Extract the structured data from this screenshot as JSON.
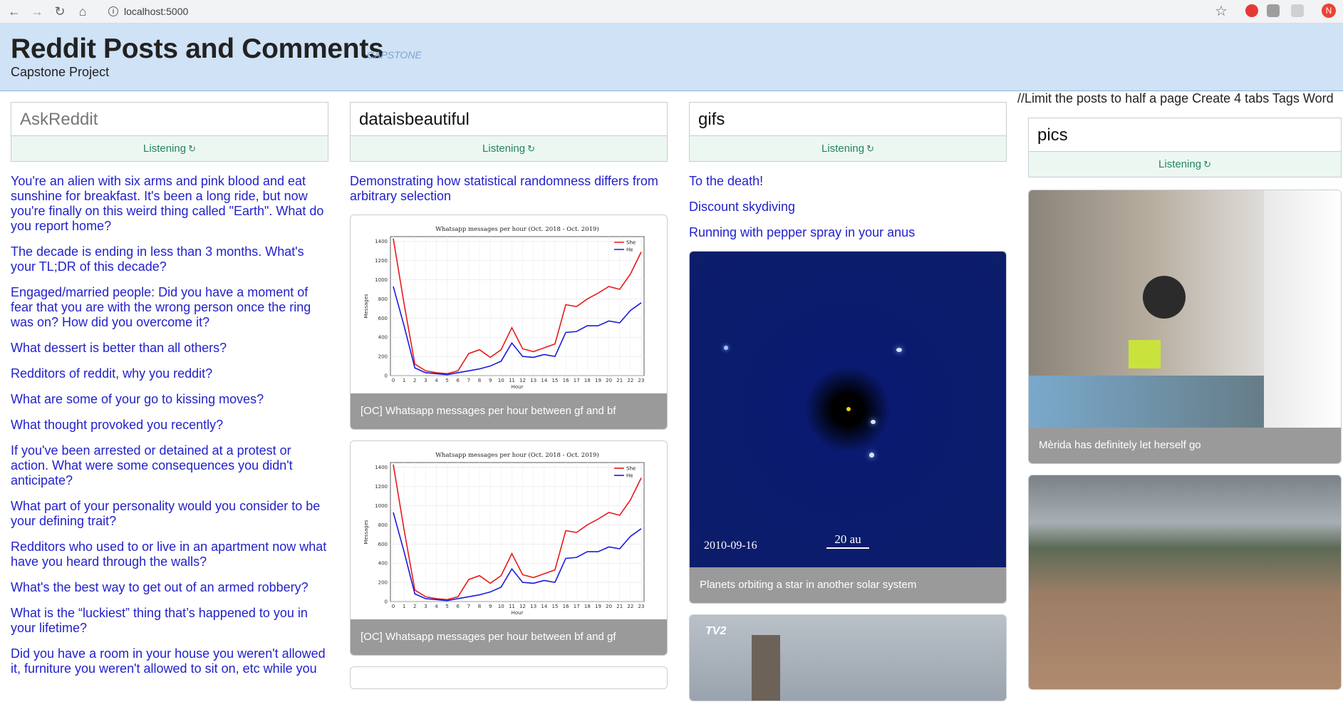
{
  "browser": {
    "url": "localhost:5000",
    "avatar_letter": "N"
  },
  "header": {
    "title": "Reddit Posts and Comments",
    "tag": "CAPSTONE",
    "subtitle": "Capstone Project",
    "note": "//Limit the posts to half a page Create 4 tabs Tags Word"
  },
  "columns": [
    {
      "subreddit": "AskReddit",
      "status": "Listening",
      "posts": [
        "You're an alien with six arms and pink blood and eat sunshine for breakfast. It's been a long ride, but now you're finally on this weird thing called \"Earth\". What do you report home?",
        "The decade is ending in less than 3 months. What's your TL;DR of this decade?",
        "Engaged/married people: Did you have a moment of fear that you are with the wrong person once the ring was on? How did you overcome it?",
        "What dessert is better than all others?",
        "Redditors of reddit, why you reddit?",
        "What are some of your go to kissing moves?",
        "What thought provoked you recently?",
        "If you've been arrested or detained at a protest or action. What were some consequences you didn't anticipate?",
        "What part of your personality would you consider to be your defining trait?",
        "Redditors who used to or live in an apartment now what have you heard through the walls?",
        "What's the best way to get out of an armed robbery?",
        "What is the “luckiest” thing that’s happened to you in your lifetime?",
        "Did you have a room in your house you weren't allowed it, furniture you weren't allowed to sit on, etc while you"
      ]
    },
    {
      "subreddit": "dataisbeautiful",
      "status": "Listening",
      "posts": [
        "Demonstrating how statistical randomness differs from arbitrary selection"
      ],
      "cards": [
        {
          "caption": "[OC] Whatsapp messages per hour between gf and bf"
        },
        {
          "caption": "[OC] Whatsapp messages per hour between bf and gf"
        }
      ]
    },
    {
      "subreddit": "gifs",
      "status": "Listening",
      "posts": [
        "To the death!",
        "Discount skydiving",
        "Running with pepper spray in your anus"
      ],
      "cards": [
        {
          "caption": "Planets orbiting a star in another solar system",
          "date": "2010-09-16",
          "scale": "20 au"
        },
        {
          "caption": "",
          "logo": "TV2"
        }
      ]
    },
    {
      "subreddit": "pics",
      "status": "Listening",
      "cards": [
        {
          "caption": "Mèrida has definitely let herself go"
        },
        {
          "caption": ""
        }
      ]
    }
  ],
  "chart_data": [
    {
      "type": "line",
      "title": "Whatsapp messages per hour (Oct. 2018 - Oct. 2019)",
      "xlabel": "Hour",
      "ylabel": "Messages",
      "categories": [
        0,
        1,
        2,
        3,
        4,
        5,
        6,
        7,
        8,
        9,
        10,
        11,
        12,
        13,
        14,
        15,
        16,
        17,
        18,
        19,
        20,
        21,
        22,
        23
      ],
      "ylim": [
        0,
        1450
      ],
      "yticks": [
        0,
        200,
        400,
        600,
        800,
        1000,
        1200,
        1400
      ],
      "series": [
        {
          "name": "She",
          "color": "#e8191b",
          "values": [
            1430,
            750,
            120,
            50,
            30,
            20,
            50,
            230,
            270,
            190,
            270,
            500,
            280,
            250,
            290,
            330,
            740,
            720,
            800,
            860,
            930,
            900,
            1060,
            1290
          ]
        },
        {
          "name": "He",
          "color": "#1a1ae0",
          "values": [
            930,
            520,
            80,
            30,
            20,
            10,
            30,
            50,
            70,
            100,
            150,
            340,
            200,
            190,
            220,
            200,
            450,
            460,
            520,
            520,
            570,
            550,
            680,
            760
          ]
        }
      ],
      "legend": "top-right",
      "grid": true
    },
    {
      "type": "line",
      "title": "Whatsapp messages per hour (Oct. 2018 - Oct. 2019)",
      "xlabel": "Hour",
      "ylabel": "Messages",
      "categories": [
        0,
        1,
        2,
        3,
        4,
        5,
        6,
        7,
        8,
        9,
        10,
        11,
        12,
        13,
        14,
        15,
        16,
        17,
        18,
        19,
        20,
        21,
        22,
        23
      ],
      "ylim": [
        0,
        1450
      ],
      "yticks": [
        0,
        200,
        400,
        600,
        800,
        1000,
        1200,
        1400
      ],
      "series": [
        {
          "name": "She",
          "color": "#e8191b",
          "values": [
            1430,
            750,
            120,
            50,
            30,
            20,
            50,
            230,
            270,
            190,
            270,
            500,
            280,
            250,
            290,
            330,
            740,
            720,
            800,
            860,
            930,
            900,
            1060,
            1290
          ]
        },
        {
          "name": "He",
          "color": "#1a1ae0",
          "values": [
            930,
            520,
            80,
            30,
            20,
            10,
            30,
            50,
            70,
            100,
            150,
            340,
            200,
            190,
            220,
            200,
            450,
            460,
            520,
            520,
            570,
            550,
            680,
            760
          ]
        }
      ],
      "legend": "top-right",
      "grid": true
    }
  ]
}
